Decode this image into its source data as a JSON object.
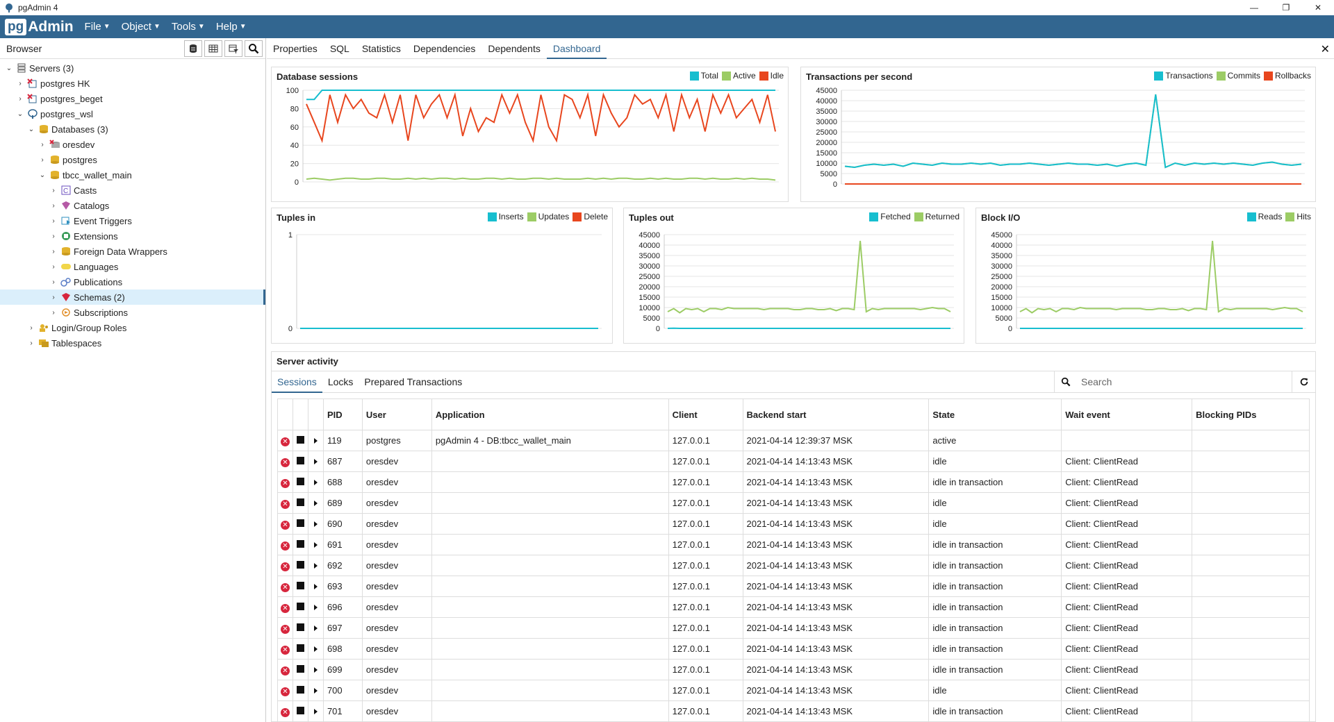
{
  "window": {
    "title": "pgAdmin 4",
    "controls": [
      "—",
      "❐",
      "✕"
    ]
  },
  "menubar": {
    "logo_pg": "pg",
    "logo_admin": "Admin",
    "items": [
      "File",
      "Object",
      "Tools",
      "Help"
    ]
  },
  "browser": {
    "title": "Browser",
    "tree": [
      {
        "label": "Servers (3)",
        "depth": 0,
        "chevron": "⌄",
        "icon": "servers-icon"
      },
      {
        "label": "postgres HK",
        "depth": 1,
        "chevron": "›",
        "icon": "server-disconnected-icon"
      },
      {
        "label": "postgres_beget",
        "depth": 1,
        "chevron": "›",
        "icon": "server-disconnected-icon"
      },
      {
        "label": "postgres_wsl",
        "depth": 1,
        "chevron": "⌄",
        "icon": "server-connected-icon"
      },
      {
        "label": "Databases (3)",
        "depth": 2,
        "chevron": "⌄",
        "icon": "databases-icon"
      },
      {
        "label": "oresdev",
        "depth": 3,
        "chevron": "›",
        "icon": "database-disconnected-icon"
      },
      {
        "label": "postgres",
        "depth": 3,
        "chevron": "›",
        "icon": "database-icon"
      },
      {
        "label": "tbcc_wallet_main",
        "depth": 3,
        "chevron": "⌄",
        "icon": "database-icon"
      },
      {
        "label": "Casts",
        "depth": 4,
        "chevron": "›",
        "icon": "casts-icon"
      },
      {
        "label": "Catalogs",
        "depth": 4,
        "chevron": "›",
        "icon": "catalogs-icon"
      },
      {
        "label": "Event Triggers",
        "depth": 4,
        "chevron": "›",
        "icon": "event-triggers-icon"
      },
      {
        "label": "Extensions",
        "depth": 4,
        "chevron": "›",
        "icon": "extensions-icon"
      },
      {
        "label": "Foreign Data Wrappers",
        "depth": 4,
        "chevron": "›",
        "icon": "foreign-data-wrappers-icon"
      },
      {
        "label": "Languages",
        "depth": 4,
        "chevron": "›",
        "icon": "languages-icon"
      },
      {
        "label": "Publications",
        "depth": 4,
        "chevron": "›",
        "icon": "publications-icon"
      },
      {
        "label": "Schemas (2)",
        "depth": 4,
        "chevron": "›",
        "icon": "schemas-icon",
        "selected": true
      },
      {
        "label": "Subscriptions",
        "depth": 4,
        "chevron": "›",
        "icon": "subscriptions-icon"
      },
      {
        "label": "Login/Group Roles",
        "depth": 2,
        "chevron": "›",
        "icon": "roles-icon"
      },
      {
        "label": "Tablespaces",
        "depth": 2,
        "chevron": "›",
        "icon": "tablespaces-icon"
      }
    ]
  },
  "tabs": [
    "Properties",
    "SQL",
    "Statistics",
    "Dependencies",
    "Dependents",
    "Dashboard"
  ],
  "active_tab": "Dashboard",
  "colors": {
    "cyan": "#17becf",
    "green": "#9ccc65",
    "red": "#e8461e",
    "accent": "#326690"
  },
  "chart_data": [
    {
      "type": "line",
      "title": "Database sessions",
      "y_ticks": [
        "100",
        "80",
        "60",
        "40",
        "20",
        "0"
      ],
      "ylim": [
        0,
        100
      ],
      "series": [
        {
          "name": "Total",
          "color": "#17becf",
          "values": [
            90,
            90,
            100,
            100,
            100,
            100,
            100,
            100,
            100,
            100,
            100,
            100,
            100,
            100,
            100,
            100,
            100,
            100,
            100,
            100,
            100,
            100,
            100,
            100,
            100,
            100,
            100,
            100,
            100,
            100,
            100,
            100,
            100,
            100,
            100,
            100,
            100,
            100,
            100,
            100,
            100,
            100,
            100,
            100,
            100,
            100,
            100,
            100,
            100,
            100,
            100,
            100,
            100,
            100,
            100,
            100,
            100,
            100,
            100,
            100,
            100
          ]
        },
        {
          "name": "Active",
          "color": "#9ccc65",
          "values": [
            3,
            4,
            3,
            2,
            3,
            4,
            4,
            3,
            3,
            4,
            4,
            3,
            3,
            4,
            3,
            4,
            3,
            4,
            4,
            3,
            4,
            3,
            3,
            4,
            4,
            3,
            4,
            3,
            3,
            4,
            4,
            3,
            4,
            3,
            3,
            3,
            4,
            3,
            4,
            3,
            4,
            4,
            3,
            3,
            4,
            3,
            4,
            3,
            3,
            4,
            4,
            3,
            4,
            3,
            3,
            4,
            3,
            4,
            3,
            3,
            2
          ]
        },
        {
          "name": "Idle",
          "color": "#e8461e",
          "values": [
            85,
            65,
            45,
            95,
            65,
            95,
            80,
            90,
            75,
            70,
            95,
            65,
            95,
            45,
            95,
            70,
            85,
            95,
            70,
            95,
            50,
            80,
            55,
            70,
            65,
            95,
            75,
            95,
            65,
            45,
            95,
            60,
            45,
            95,
            90,
            70,
            95,
            50,
            95,
            75,
            60,
            70,
            95,
            85,
            90,
            70,
            95,
            55,
            95,
            70,
            90,
            55,
            95,
            75,
            95,
            70,
            80,
            90,
            65,
            95,
            55
          ]
        }
      ]
    },
    {
      "type": "line",
      "title": "Transactions per second",
      "y_ticks": [
        "45000",
        "40000",
        "35000",
        "30000",
        "25000",
        "20000",
        "15000",
        "10000",
        "5000",
        "0"
      ],
      "ylim": [
        0,
        45000
      ],
      "series": [
        {
          "name": "Transactions",
          "color": "#17becf",
          "values": [
            8500,
            8000,
            9000,
            9500,
            9000,
            9500,
            8500,
            10000,
            9500,
            9000,
            10000,
            9500,
            9500,
            10000,
            9500,
            10000,
            9000,
            9500,
            9500,
            10000,
            9500,
            9000,
            9500,
            10000,
            9500,
            9500,
            9000,
            9500,
            8500,
            9500,
            10000,
            9000,
            43000,
            8000,
            10000,
            9000,
            10000,
            9500,
            10000,
            9500,
            10000,
            9500,
            9000,
            10000,
            10500,
            9500,
            9000,
            9500
          ]
        },
        {
          "name": "Commits",
          "color": "#9ccc65",
          "values": [
            8500,
            8000,
            9000,
            9500,
            9000,
            9500,
            8500,
            10000,
            9500,
            9000,
            10000,
            9500,
            9500,
            10000,
            9500,
            10000,
            9000,
            9500,
            9500,
            10000,
            9500,
            9000,
            9500,
            10000,
            9500,
            9500,
            9000,
            9500,
            8500,
            9500,
            10000,
            9000,
            43000,
            8000,
            10000,
            9000,
            10000,
            9500,
            10000,
            9500,
            10000,
            9500,
            9000,
            10000,
            10500,
            9500,
            9000,
            9500
          ]
        },
        {
          "name": "Rollbacks",
          "color": "#e8461e",
          "values": [
            0,
            0,
            0,
            0,
            0,
            0,
            0,
            0,
            0,
            0,
            0,
            0,
            0,
            0,
            0,
            0,
            0,
            0,
            0,
            0,
            0,
            0,
            0,
            0,
            0,
            0,
            0,
            0,
            0,
            0,
            0,
            0,
            0,
            0,
            0,
            0,
            0,
            0,
            0,
            0,
            0,
            0,
            0,
            0,
            0,
            0,
            0,
            0
          ]
        }
      ]
    },
    {
      "type": "line",
      "title": "Tuples in",
      "y_ticks": [
        "1",
        "0"
      ],
      "ylim": [
        0,
        1
      ],
      "series": [
        {
          "name": "Inserts",
          "color": "#17becf",
          "values": [
            0,
            0,
            0,
            0,
            0,
            0,
            0,
            0,
            0,
            0
          ]
        },
        {
          "name": "Updates",
          "color": "#9ccc65",
          "values": [
            0,
            0,
            0,
            0,
            0,
            0,
            0,
            0,
            0,
            0
          ]
        },
        {
          "name": "Delete",
          "color": "#e8461e",
          "values": [
            0,
            0,
            0,
            0,
            0,
            0,
            0,
            0,
            0,
            0
          ]
        }
      ]
    },
    {
      "type": "line",
      "title": "Tuples out",
      "y_ticks": [
        "45000",
        "40000",
        "35000",
        "30000",
        "25000",
        "20000",
        "15000",
        "10000",
        "5000",
        "0"
      ],
      "ylim": [
        0,
        45000
      ],
      "series": [
        {
          "name": "Fetched",
          "color": "#17becf",
          "values": [
            0,
            100,
            0,
            0,
            0,
            0,
            0,
            0,
            0,
            0,
            0,
            0,
            0,
            0,
            0,
            0,
            0,
            0,
            0,
            0,
            0,
            0,
            0,
            0,
            0,
            0,
            0,
            0,
            0,
            0,
            0,
            0,
            0,
            0,
            0,
            0,
            0,
            0,
            0,
            0,
            0,
            0,
            0,
            0,
            0,
            0,
            0,
            0
          ]
        },
        {
          "name": "Returned",
          "color": "#9ccc65",
          "values": [
            8000,
            9500,
            7500,
            9500,
            9000,
            9500,
            8000,
            9500,
            9500,
            9000,
            10000,
            9500,
            9500,
            9500,
            9500,
            9500,
            9000,
            9500,
            9500,
            9500,
            9500,
            9000,
            9000,
            9500,
            9500,
            9000,
            9000,
            9500,
            8500,
            9500,
            9500,
            9000,
            42000,
            8000,
            9500,
            9000,
            9500,
            9500,
            9500,
            9500,
            9500,
            9500,
            9000,
            9500,
            10000,
            9500,
            9500,
            8000
          ]
        }
      ]
    },
    {
      "type": "line",
      "title": "Block I/O",
      "y_ticks": [
        "45000",
        "40000",
        "35000",
        "30000",
        "25000",
        "20000",
        "15000",
        "10000",
        "5000",
        "0"
      ],
      "ylim": [
        0,
        45000
      ],
      "series": [
        {
          "name": "Reads",
          "color": "#17becf",
          "values": [
            0,
            0,
            0,
            0,
            0,
            0,
            0,
            0,
            0,
            0,
            0,
            0,
            0,
            0,
            0,
            0,
            0,
            0,
            0,
            0,
            0,
            0,
            0,
            0,
            0,
            0,
            0,
            0,
            0,
            0,
            0,
            0,
            0,
            0,
            0,
            0,
            0,
            0,
            0,
            0,
            0,
            0,
            0,
            0,
            0,
            0,
            0,
            0
          ]
        },
        {
          "name": "Hits",
          "color": "#9ccc65",
          "values": [
            8000,
            9500,
            7500,
            9500,
            9000,
            9500,
            8000,
            9500,
            9500,
            9000,
            10000,
            9500,
            9500,
            9500,
            9500,
            9500,
            9000,
            9500,
            9500,
            9500,
            9500,
            9000,
            9000,
            9500,
            9500,
            9000,
            9000,
            9500,
            8500,
            9500,
            9500,
            9000,
            42000,
            8000,
            9500,
            9000,
            9500,
            9500,
            9500,
            9500,
            9500,
            9500,
            9000,
            9500,
            10000,
            9500,
            9500,
            8000
          ]
        }
      ]
    }
  ],
  "activity": {
    "title": "Server activity",
    "subtabs": [
      "Sessions",
      "Locks",
      "Prepared Transactions"
    ],
    "active_subtab": "Sessions",
    "search_placeholder": "Search",
    "columns": [
      "PID",
      "User",
      "Application",
      "Client",
      "Backend start",
      "State",
      "Wait event",
      "Blocking PIDs"
    ],
    "rows": [
      [
        "119",
        "postgres",
        "pgAdmin 4 - DB:tbcc_wallet_main",
        "127.0.0.1",
        "2021-04-14 12:39:37 MSK",
        "active",
        "",
        ""
      ],
      [
        "687",
        "oresdev",
        "",
        "127.0.0.1",
        "2021-04-14 14:13:43 MSK",
        "idle",
        "Client: ClientRead",
        ""
      ],
      [
        "688",
        "oresdev",
        "",
        "127.0.0.1",
        "2021-04-14 14:13:43 MSK",
        "idle in transaction",
        "Client: ClientRead",
        ""
      ],
      [
        "689",
        "oresdev",
        "",
        "127.0.0.1",
        "2021-04-14 14:13:43 MSK",
        "idle",
        "Client: ClientRead",
        ""
      ],
      [
        "690",
        "oresdev",
        "",
        "127.0.0.1",
        "2021-04-14 14:13:43 MSK",
        "idle",
        "Client: ClientRead",
        ""
      ],
      [
        "691",
        "oresdev",
        "",
        "127.0.0.1",
        "2021-04-14 14:13:43 MSK",
        "idle in transaction",
        "Client: ClientRead",
        ""
      ],
      [
        "692",
        "oresdev",
        "",
        "127.0.0.1",
        "2021-04-14 14:13:43 MSK",
        "idle in transaction",
        "Client: ClientRead",
        ""
      ],
      [
        "693",
        "oresdev",
        "",
        "127.0.0.1",
        "2021-04-14 14:13:43 MSK",
        "idle in transaction",
        "Client: ClientRead",
        ""
      ],
      [
        "696",
        "oresdev",
        "",
        "127.0.0.1",
        "2021-04-14 14:13:43 MSK",
        "idle in transaction",
        "Client: ClientRead",
        ""
      ],
      [
        "697",
        "oresdev",
        "",
        "127.0.0.1",
        "2021-04-14 14:13:43 MSK",
        "idle in transaction",
        "Client: ClientRead",
        ""
      ],
      [
        "698",
        "oresdev",
        "",
        "127.0.0.1",
        "2021-04-14 14:13:43 MSK",
        "idle in transaction",
        "Client: ClientRead",
        ""
      ],
      [
        "699",
        "oresdev",
        "",
        "127.0.0.1",
        "2021-04-14 14:13:43 MSK",
        "idle in transaction",
        "Client: ClientRead",
        ""
      ],
      [
        "700",
        "oresdev",
        "",
        "127.0.0.1",
        "2021-04-14 14:13:43 MSK",
        "idle",
        "Client: ClientRead",
        ""
      ],
      [
        "701",
        "oresdev",
        "",
        "127.0.0.1",
        "2021-04-14 14:13:43 MSK",
        "idle in transaction",
        "Client: ClientRead",
        ""
      ]
    ]
  }
}
